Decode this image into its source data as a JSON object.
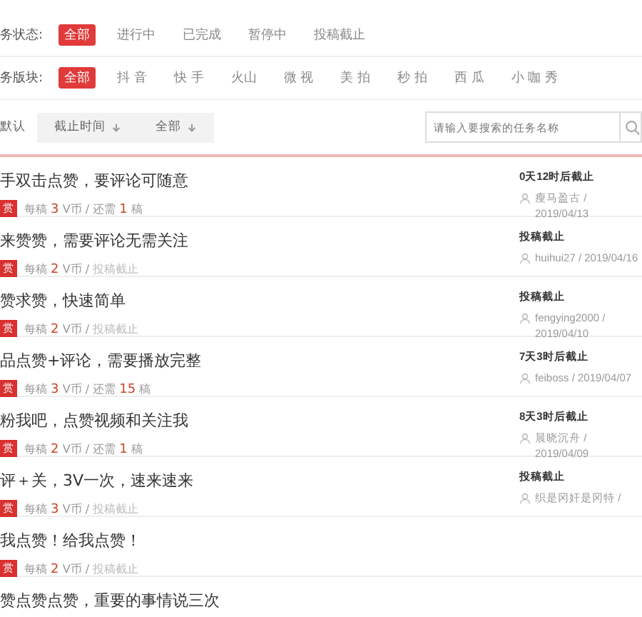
{
  "filters": [
    {
      "label": "务状态:",
      "options": [
        {
          "label": "全部",
          "selected": true
        },
        {
          "label": "进行中",
          "selected": false
        },
        {
          "label": "已完成",
          "selected": false
        },
        {
          "label": "暂停中",
          "selected": false
        },
        {
          "label": "投稿截止",
          "selected": false
        }
      ]
    },
    {
      "label": "务版块:",
      "options": [
        {
          "label": "全部",
          "selected": true
        },
        {
          "label": "抖 音",
          "selected": false
        },
        {
          "label": "快 手",
          "selected": false
        },
        {
          "label": "火山",
          "selected": false
        },
        {
          "label": "微 视",
          "selected": false
        },
        {
          "label": "美 拍",
          "selected": false
        },
        {
          "label": "秒 拍",
          "selected": false
        },
        {
          "label": "西 瓜",
          "selected": false
        },
        {
          "label": "小 咖 秀",
          "selected": false
        }
      ]
    }
  ],
  "sort_tabs": [
    {
      "label": "默认",
      "selected": true,
      "arrow": false
    },
    {
      "label": "截止时间",
      "selected": false,
      "arrow": true
    },
    {
      "label": "全部",
      "selected": false,
      "arrow": true
    }
  ],
  "search": {
    "placeholder": "请输入要搜索的任务名称"
  },
  "tasks": [
    {
      "title": "手双击点赞，要评论可随意",
      "tag": "赏",
      "price_label": "每稿",
      "price": "3",
      "unit": "V币 /",
      "kind": "remaining",
      "remaining_label": "还需",
      "remaining": "1",
      "remaining_unit": "稿",
      "deadline": "0天12时后截止",
      "author": "瘦马盈古 / 2019/04/13"
    },
    {
      "title": "来赞赞，需要评论无需关注",
      "tag": "赏",
      "price_label": "每稿",
      "price": "2",
      "unit": "V币 /",
      "kind": "closed",
      "closed_label": "投稿截止",
      "deadline": "投稿截止",
      "author": "huihui27 / 2019/04/16"
    },
    {
      "title": "赞求赞，快速简单",
      "tag": "赏",
      "price_label": "每稿",
      "price": "2",
      "unit": "V币 /",
      "kind": "closed",
      "closed_label": "投稿截止",
      "deadline": "投稿截止",
      "author": "fengying2000 / 2019/04/10"
    },
    {
      "title": "品点赞+评论，需要播放完整",
      "tag": "赏",
      "price_label": "每稿",
      "price": "3",
      "unit": "V币 /",
      "kind": "remaining",
      "remaining_label": "还需",
      "remaining": "15",
      "remaining_unit": "稿",
      "deadline": "7天3时后截止",
      "author": "feiboss / 2019/04/07"
    },
    {
      "title": "粉我吧，点赞视频和关注我",
      "tag": "赏",
      "price_label": "每稿",
      "price": "2",
      "unit": "V币 /",
      "kind": "remaining",
      "remaining_label": "还需",
      "remaining": "1",
      "remaining_unit": "稿",
      "deadline": "8天3时后截止",
      "author": "晨晓沉舟 / 2019/04/09"
    },
    {
      "title": "评＋关，3V一次，速来速来",
      "tag": "赏",
      "price_label": "每稿",
      "price": "3",
      "unit": "V币 /",
      "kind": "closed",
      "closed_label": "投稿截止",
      "deadline": "投稿截止",
      "author": "织是冈奸是冈特 /"
    },
    {
      "title": "我点赞！给我点赞！",
      "tag": "赏",
      "price_label": "每稿",
      "price": "2",
      "unit": "V币 /",
      "kind": "closed",
      "closed_label": "投稿截止"
    },
    {
      "title": "赞点赞点赞，重要的事情说三次"
    }
  ]
}
